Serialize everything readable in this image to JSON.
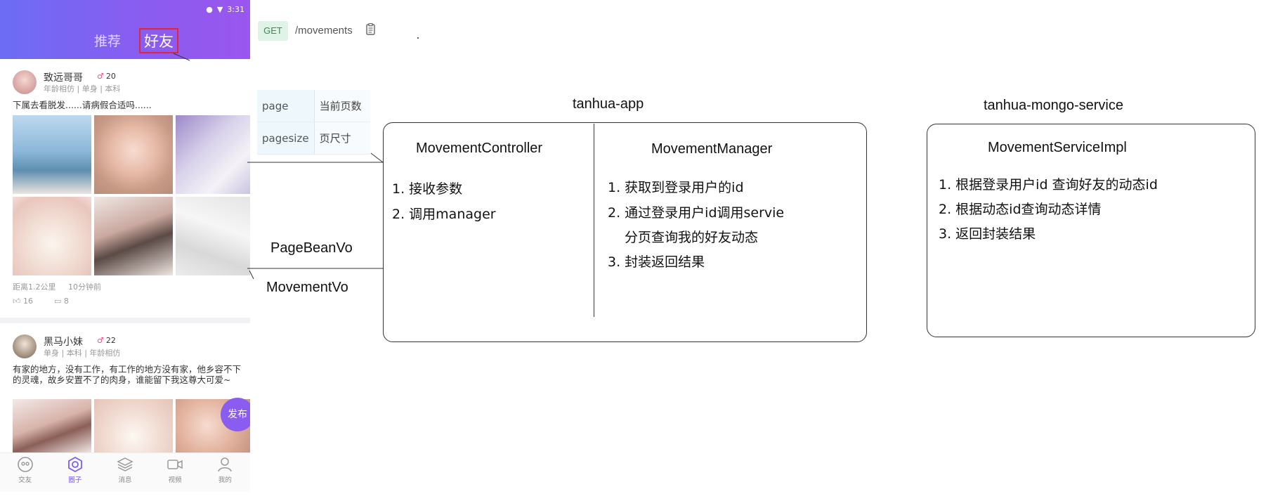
{
  "phone": {
    "status_time": "3:31",
    "tabs": {
      "recommend": "推荐",
      "friends": "好友"
    },
    "posts": [
      {
        "username": "致远哥哥",
        "age": "20",
        "meta": "年龄相仿 | 单身 | 本科",
        "text": "下属去看脱发......请病假合适吗......",
        "distance": "距离1.2公里",
        "time": "10分钟前",
        "likes": "16",
        "comments": "8"
      },
      {
        "username": "黑马小妹",
        "age": "22",
        "meta": "单身 | 本科 | 年龄相仿",
        "text": "有家的地方，没有工作，有工作的地方没有家，他乡容不下的灵魂，故乡安置不了的肉身，谁能留下我这尊大可爱~"
      }
    ],
    "publish_button": "发布",
    "bottom_nav": [
      "交友",
      "圈子",
      "消息",
      "视频",
      "我的"
    ]
  },
  "api": {
    "method": "GET",
    "path": "/movements",
    "params": [
      {
        "name": "page",
        "desc": "当前页数"
      },
      {
        "name": "pagesize",
        "desc": "页尺寸"
      }
    ]
  },
  "diagram": {
    "app_title": "tanhua-app",
    "service_title": "tanhua-mongo-service",
    "controller": {
      "title": "MovementController",
      "steps": [
        "1. 接收参数",
        "2. 调用manager"
      ]
    },
    "manager": {
      "title": "MovementManager",
      "steps": [
        "1. 获取到登录用户的id",
        "2. 通过登录用户id调用servie",
        "分页查询我的好友动态",
        "3. 封装返回结果"
      ]
    },
    "service_impl": {
      "title": "MovementServiceImpl",
      "steps": [
        "1. 根据登录用户id 查询好友的动态id",
        "2. 根据动态id查询动态详情",
        "3. 返回封装结果"
      ]
    },
    "return_labels": [
      "PageBeanVo",
      "MovementVo"
    ]
  }
}
